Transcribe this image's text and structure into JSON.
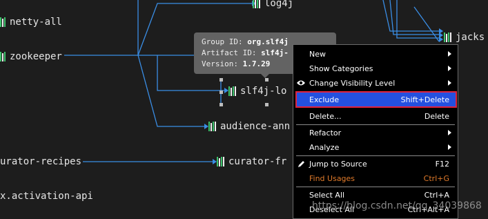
{
  "nodes": {
    "netty_all": "netty-all",
    "zookeeper": "zookeeper",
    "log4j": "log4j",
    "jackson": "jacks",
    "slf4j": "slf4j-lo",
    "audience": "audience-ann",
    "curator_recipes": "urator-recipes",
    "curator_fr": "curator-fr",
    "activation": "x.activation-api"
  },
  "tooltip": {
    "group_label": "Group ID:",
    "group_value": "org.slf4j",
    "artifact_label": "Artifact ID:",
    "artifact_value": "slf4j-",
    "version_label": "Version:",
    "version_value": "1.7.29"
  },
  "context_menu": {
    "new": "New",
    "show_categories": "Show Categories",
    "change_visibility": "Change Visibility Level",
    "exclude": "Exclude",
    "exclude_shortcut": "Shift+Delete",
    "delete": "Delete...",
    "delete_shortcut": "Delete",
    "refactor": "Refactor",
    "analyze": "Analyze",
    "jump_to_source": "Jump to Source",
    "jump_shortcut": "F12",
    "find_usages": "Find Usages",
    "find_shortcut": "Ctrl+G",
    "select_all": "Select All",
    "select_all_shortcut": "Ctrl+A",
    "deselect_all": "Deselect All",
    "deselect_all_shortcut": "Ctrl+Alt+A"
  },
  "watermark": "https://blog.csdn.net/qq_34039868",
  "colors": {
    "background": "#1d1d1d",
    "edge": "#3a8ee6",
    "library_green": "#3ec46d",
    "selection": "#2450e0",
    "selection_border": "#e0233c",
    "find_usages": "#e07a2a"
  }
}
